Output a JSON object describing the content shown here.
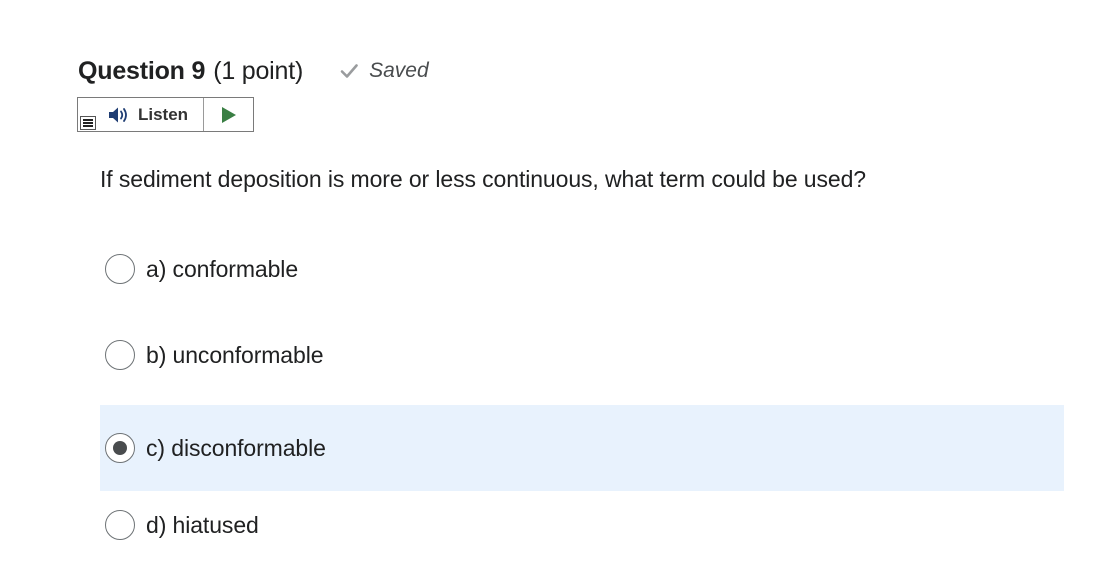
{
  "question": {
    "title": "Question 9",
    "points": "(1 point)",
    "saved_label": "Saved",
    "saved_icon": "checkmark-icon",
    "text": "If sediment deposition is more or less continuous, what term could be used?"
  },
  "listen": {
    "label": "Listen",
    "speaker_icon": "speaker-icon",
    "play_icon": "play-icon",
    "menu_icon": "menu-icon",
    "play_color": "#3a7f44"
  },
  "options": [
    {
      "label": "a) conformable",
      "selected": false
    },
    {
      "label": "b) unconformable",
      "selected": false
    },
    {
      "label": "c) disconformable",
      "selected": true
    },
    {
      "label": "d) hiatused",
      "selected": false
    }
  ],
  "colors": {
    "selected_background": "#e8f2fd",
    "text": "#202122",
    "muted": "#494c4e"
  }
}
